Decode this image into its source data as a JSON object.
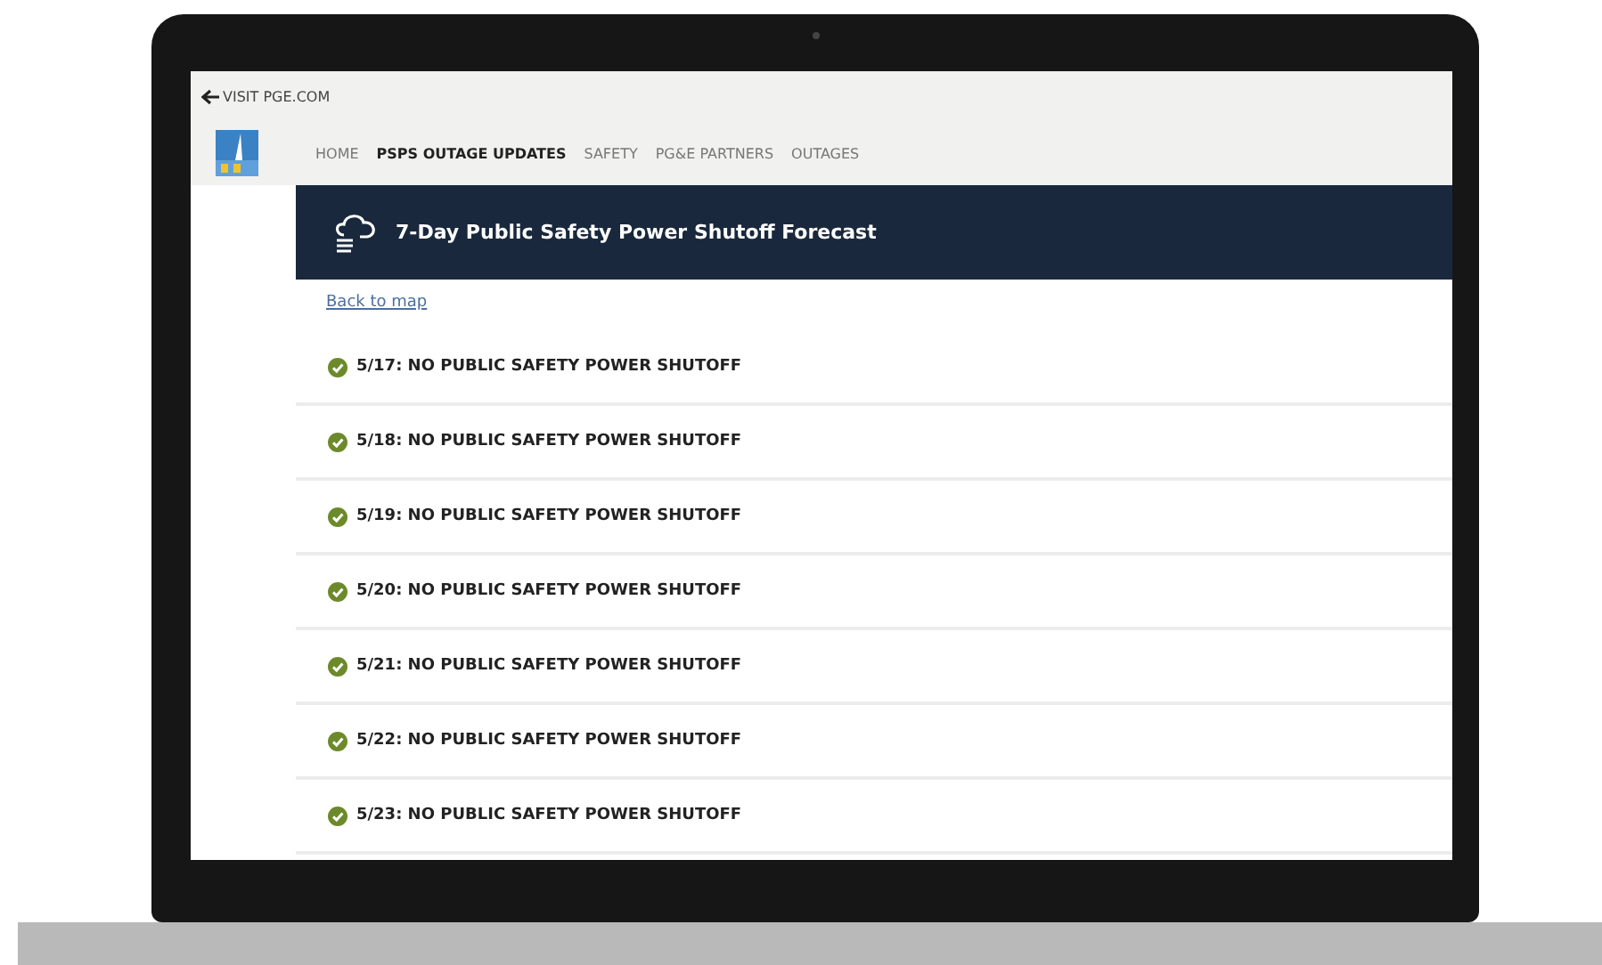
{
  "top_bar": {
    "back_link": "VISIT PGE.COM"
  },
  "nav": [
    {
      "label": "HOME",
      "selected": false
    },
    {
      "label": "PSPS OUTAGE UPDATES",
      "selected": true
    },
    {
      "label": "SAFETY",
      "selected": false
    },
    {
      "label": "PG&E PARTNERS",
      "selected": false
    },
    {
      "label": "OUTAGES",
      "selected": false
    }
  ],
  "banner": {
    "title": "7-Day Public Safety Power Shutoff Forecast"
  },
  "back_link": "Back to map",
  "forecast": [
    {
      "label": "5/17: NO PUBLIC SAFETY POWER SHUTOFF"
    },
    {
      "label": "5/18: NO PUBLIC SAFETY POWER SHUTOFF"
    },
    {
      "label": "5/19: NO PUBLIC SAFETY POWER SHUTOFF"
    },
    {
      "label": "5/20: NO PUBLIC SAFETY POWER SHUTOFF"
    },
    {
      "label": "5/21: NO PUBLIC SAFETY POWER SHUTOFF"
    },
    {
      "label": "5/22: NO PUBLIC SAFETY POWER SHUTOFF"
    },
    {
      "label": "5/23: NO PUBLIC SAFETY POWER SHUTOFF"
    }
  ]
}
